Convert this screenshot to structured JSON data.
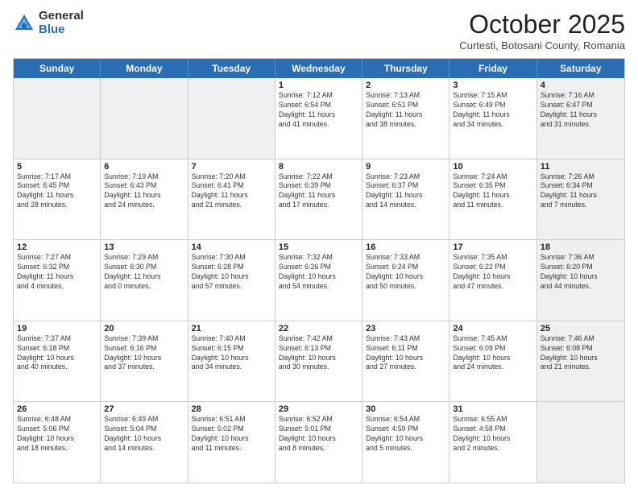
{
  "header": {
    "logo_general": "General",
    "logo_blue": "Blue",
    "month_title": "October 2025",
    "location": "Curtesti, Botosani County, Romania"
  },
  "days_of_week": [
    "Sunday",
    "Monday",
    "Tuesday",
    "Wednesday",
    "Thursday",
    "Friday",
    "Saturday"
  ],
  "weeks": [
    [
      {
        "day": "",
        "text": "",
        "shaded": true
      },
      {
        "day": "",
        "text": "",
        "shaded": true
      },
      {
        "day": "",
        "text": "",
        "shaded": true
      },
      {
        "day": "1",
        "text": "Sunrise: 7:12 AM\nSunset: 6:54 PM\nDaylight: 11 hours\nand 41 minutes."
      },
      {
        "day": "2",
        "text": "Sunrise: 7:13 AM\nSunset: 6:51 PM\nDaylight: 11 hours\nand 38 minutes."
      },
      {
        "day": "3",
        "text": "Sunrise: 7:15 AM\nSunset: 6:49 PM\nDaylight: 11 hours\nand 34 minutes."
      },
      {
        "day": "4",
        "text": "Sunrise: 7:16 AM\nSunset: 6:47 PM\nDaylight: 11 hours\nand 31 minutes.",
        "shaded": true
      }
    ],
    [
      {
        "day": "5",
        "text": "Sunrise: 7:17 AM\nSunset: 6:45 PM\nDaylight: 11 hours\nand 28 minutes."
      },
      {
        "day": "6",
        "text": "Sunrise: 7:19 AM\nSunset: 6:43 PM\nDaylight: 11 hours\nand 24 minutes."
      },
      {
        "day": "7",
        "text": "Sunrise: 7:20 AM\nSunset: 6:41 PM\nDaylight: 11 hours\nand 21 minutes."
      },
      {
        "day": "8",
        "text": "Sunrise: 7:22 AM\nSunset: 6:39 PM\nDaylight: 11 hours\nand 17 minutes."
      },
      {
        "day": "9",
        "text": "Sunrise: 7:23 AM\nSunset: 6:37 PM\nDaylight: 11 hours\nand 14 minutes."
      },
      {
        "day": "10",
        "text": "Sunrise: 7:24 AM\nSunset: 6:35 PM\nDaylight: 11 hours\nand 11 minutes."
      },
      {
        "day": "11",
        "text": "Sunrise: 7:26 AM\nSunset: 6:34 PM\nDaylight: 11 hours\nand 7 minutes.",
        "shaded": true
      }
    ],
    [
      {
        "day": "12",
        "text": "Sunrise: 7:27 AM\nSunset: 6:32 PM\nDaylight: 11 hours\nand 4 minutes."
      },
      {
        "day": "13",
        "text": "Sunrise: 7:29 AM\nSunset: 6:30 PM\nDaylight: 11 hours\nand 0 minutes."
      },
      {
        "day": "14",
        "text": "Sunrise: 7:30 AM\nSunset: 6:28 PM\nDaylight: 10 hours\nand 57 minutes."
      },
      {
        "day": "15",
        "text": "Sunrise: 7:32 AM\nSunset: 6:26 PM\nDaylight: 10 hours\nand 54 minutes."
      },
      {
        "day": "16",
        "text": "Sunrise: 7:33 AM\nSunset: 6:24 PM\nDaylight: 10 hours\nand 50 minutes."
      },
      {
        "day": "17",
        "text": "Sunrise: 7:35 AM\nSunset: 6:22 PM\nDaylight: 10 hours\nand 47 minutes."
      },
      {
        "day": "18",
        "text": "Sunrise: 7:36 AM\nSunset: 6:20 PM\nDaylight: 10 hours\nand 44 minutes.",
        "shaded": true
      }
    ],
    [
      {
        "day": "19",
        "text": "Sunrise: 7:37 AM\nSunset: 6:18 PM\nDaylight: 10 hours\nand 40 minutes."
      },
      {
        "day": "20",
        "text": "Sunrise: 7:39 AM\nSunset: 6:16 PM\nDaylight: 10 hours\nand 37 minutes."
      },
      {
        "day": "21",
        "text": "Sunrise: 7:40 AM\nSunset: 6:15 PM\nDaylight: 10 hours\nand 34 minutes."
      },
      {
        "day": "22",
        "text": "Sunrise: 7:42 AM\nSunset: 6:13 PM\nDaylight: 10 hours\nand 30 minutes."
      },
      {
        "day": "23",
        "text": "Sunrise: 7:43 AM\nSunset: 6:11 PM\nDaylight: 10 hours\nand 27 minutes."
      },
      {
        "day": "24",
        "text": "Sunrise: 7:45 AM\nSunset: 6:09 PM\nDaylight: 10 hours\nand 24 minutes."
      },
      {
        "day": "25",
        "text": "Sunrise: 7:46 AM\nSunset: 6:08 PM\nDaylight: 10 hours\nand 21 minutes.",
        "shaded": true
      }
    ],
    [
      {
        "day": "26",
        "text": "Sunrise: 6:48 AM\nSunset: 5:06 PM\nDaylight: 10 hours\nand 18 minutes."
      },
      {
        "day": "27",
        "text": "Sunrise: 6:49 AM\nSunset: 5:04 PM\nDaylight: 10 hours\nand 14 minutes."
      },
      {
        "day": "28",
        "text": "Sunrise: 6:51 AM\nSunset: 5:02 PM\nDaylight: 10 hours\nand 11 minutes."
      },
      {
        "day": "29",
        "text": "Sunrise: 6:52 AM\nSunset: 5:01 PM\nDaylight: 10 hours\nand 8 minutes."
      },
      {
        "day": "30",
        "text": "Sunrise: 6:54 AM\nSunset: 4:59 PM\nDaylight: 10 hours\nand 5 minutes."
      },
      {
        "day": "31",
        "text": "Sunrise: 6:55 AM\nSunset: 4:58 PM\nDaylight: 10 hours\nand 2 minutes."
      },
      {
        "day": "",
        "text": "",
        "shaded": true
      }
    ]
  ]
}
